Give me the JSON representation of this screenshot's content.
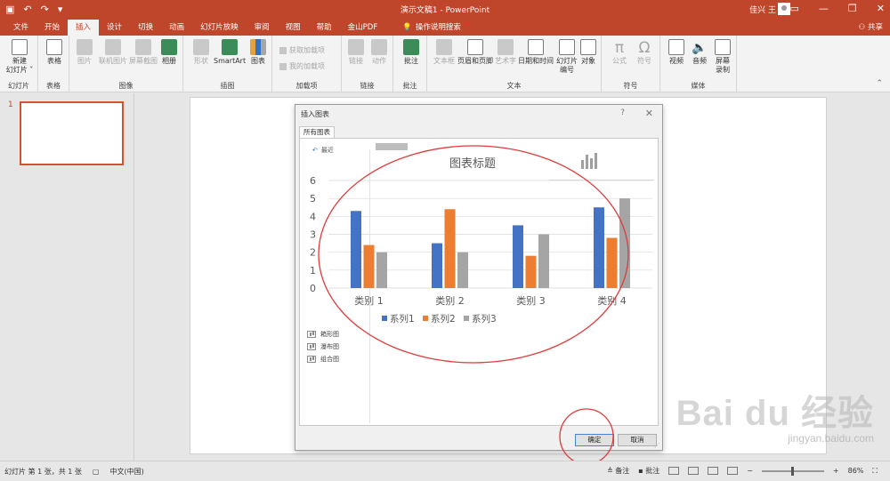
{
  "window": {
    "title": "演示文稿1  -  PowerPoint",
    "user": "佳兴 王",
    "qat_icons": [
      "save-icon",
      "undo-icon",
      "redo-icon",
      "customize-icon"
    ]
  },
  "tabs": [
    "文件",
    "开始",
    "插入",
    "设计",
    "切换",
    "动画",
    "幻灯片放映",
    "审阅",
    "视图",
    "帮助",
    "金山PDF"
  ],
  "active_tab": "插入",
  "tell_me": "操作说明搜索",
  "share": "共享",
  "ribbon": {
    "groups": {
      "slides": "幻灯片",
      "tables": "表格",
      "images": "图像",
      "illustrations": "插图",
      "addins": "加载项",
      "links": "链接",
      "comments": "批注",
      "text": "文本",
      "symbols": "符号",
      "media": "媒体"
    },
    "buttons": {
      "new_slide": "新建\n幻灯片 ˅",
      "table": "表格",
      "picture": "图片",
      "online_picture": "联机图片",
      "screenshot": "屏幕截图",
      "album": "相册",
      "shapes": "形状",
      "smartart": "SmartArt",
      "chart": "图表",
      "get_addins": "获取加载项",
      "my_addins": "我的加载项",
      "link": "链接",
      "action": "动作",
      "comment": "批注",
      "textbox": "文本框",
      "header_footer": "页眉和页脚",
      "wordart": "艺术字",
      "datetime": "日期和时间",
      "slide_number": "幻灯片\n编号",
      "object": "对象",
      "equation": "公式",
      "symbol": "符号",
      "video": "视频",
      "audio": "音频",
      "screen_record": "屏幕\n录制"
    }
  },
  "slide_pane": {
    "slide_number": "1"
  },
  "dialog": {
    "title": "插入图表",
    "help": "?",
    "tab": "所有图表",
    "recent": "最近",
    "chart_types": [
      "箱形图",
      "瀑布图",
      "组合图"
    ],
    "ok": "确定",
    "cancel": "取消"
  },
  "chart_data": {
    "type": "bar",
    "title": "图表标题",
    "categories": [
      "类别 1",
      "类别 2",
      "类别 3",
      "类别 4"
    ],
    "series": [
      {
        "name": "系列1",
        "values": [
          4.3,
          2.5,
          3.5,
          4.5
        ],
        "color": "#4472C4"
      },
      {
        "name": "系列2",
        "values": [
          2.4,
          4.4,
          1.8,
          2.8
        ],
        "color": "#ED7D31"
      },
      {
        "name": "系列3",
        "values": [
          2.0,
          2.0,
          3.0,
          5.0
        ],
        "color": "#A5A5A5"
      }
    ],
    "ylim": [
      0,
      6
    ],
    "yticks": [
      0,
      1,
      2,
      3,
      4,
      5,
      6
    ],
    "grid": true,
    "legend": "bottom"
  },
  "status": {
    "slide_info": "幻灯片 第 1 张，共 1 张",
    "language": "中文(中国)",
    "notes": "备注",
    "comments": "批注",
    "zoom": "86%"
  },
  "watermark": {
    "line1": "Bai du 经验",
    "line2": "jingyan.baidu.com"
  },
  "colors": {
    "accent": "#C0462B",
    "annotation": "#E03A3A"
  }
}
